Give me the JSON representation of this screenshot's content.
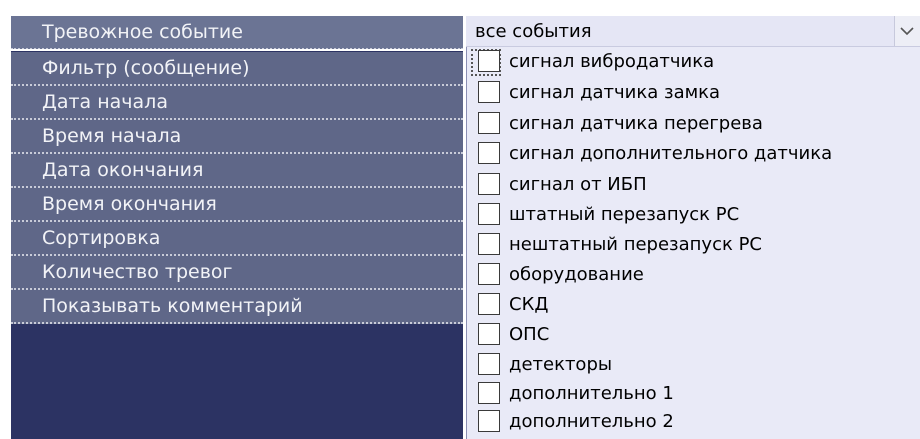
{
  "parameters": [
    "Тревожное событие",
    "Фильтр (сообщение)",
    "Дата начала",
    "Время начала",
    "Дата окончания",
    "Время окончания",
    "Сортировка",
    "Количество тревог",
    "Показывать комментарий"
  ],
  "event_combo": {
    "value": "все события",
    "button_icon": "chevron-down-icon"
  },
  "event_options": [
    "сигнал вибродатчика",
    "сигнал датчика замка",
    "сигнал датчика перегрева",
    "сигнал дополнительного датчика",
    "сигнал от ИБП",
    "штатный перезапуск РС",
    "нештатный перезапуск РС",
    "оборудование",
    "СКД",
    "ОПС",
    "детекторы",
    "дополнительно 1",
    "дополнительно 2"
  ],
  "colors": {
    "panel_bg": "#2c3363",
    "row_bg": "#5f6788",
    "list_bg": "#e9eaf7"
  }
}
